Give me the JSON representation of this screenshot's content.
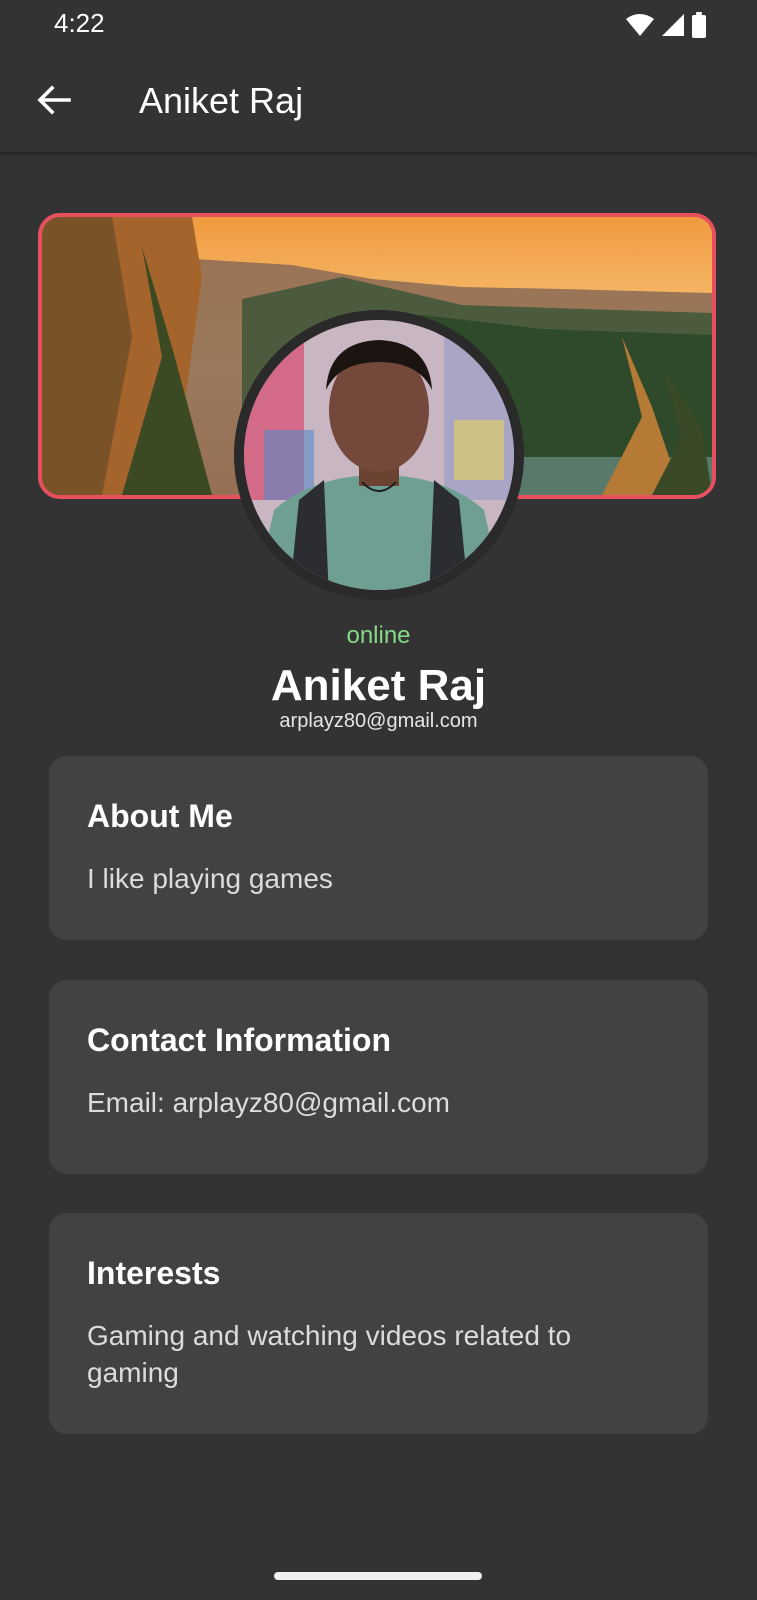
{
  "status_bar": {
    "time": "4:22",
    "icons": [
      "wifi-icon",
      "cellular-signal-icon",
      "battery-icon"
    ]
  },
  "app_bar": {
    "back_icon": "arrow-left-icon",
    "title": "Aniket Raj"
  },
  "profile": {
    "status": "online",
    "name": "Aniket Raj",
    "email": "arplayz80@gmail.com"
  },
  "cards": {
    "about": {
      "title": "About Me",
      "body": "I like playing games"
    },
    "contact": {
      "title": "Contact Information",
      "body": "Email: arplayz80@gmail.com"
    },
    "interests": {
      "title": "Interests",
      "body": "Gaming and watching videos related to gaming"
    }
  },
  "colors": {
    "background": "#333333",
    "card": "#424242",
    "cover_border": "#e8505f",
    "online": "#86d989"
  }
}
